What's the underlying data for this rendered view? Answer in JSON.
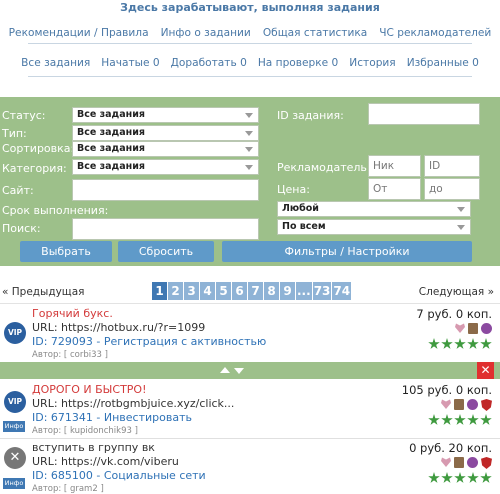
{
  "header": {
    "title": "Здесь зарабатывают, выполняя задания"
  },
  "nav_top": [
    "Рекомендации / Правила",
    "Инфо о задании",
    "Общая статистика",
    "ЧС рекламодателей"
  ],
  "nav_tabs": [
    "Все задания",
    "Начатые 0",
    "Доработать 0",
    "На проверке 0",
    "История",
    "Избранные 0"
  ],
  "filter": {
    "status_label": "Статус:",
    "status_value": "Все задания",
    "type_label": "Тип:",
    "type_value": "Все задания",
    "sort_label": "Сортировка:",
    "sort_value": "Все задания",
    "category_label": "Категория:",
    "category_value": "Все задания",
    "site_label": "Сайт:",
    "deadline_label": "Срок выполнения:",
    "search_label": "Поиск:",
    "task_id_label": "ID задания:",
    "advertiser_label": "Рекламодатель:",
    "nick_placeholder": "Ник",
    "id_placeholder": "ID",
    "price_label": "Цена:",
    "from_placeholder": "От",
    "to_placeholder": "до",
    "any_value": "Любой",
    "all_value": "По всем",
    "select_button": "Выбрать",
    "reset_button": "Сбросить",
    "settings_button": "Фильтры / Настройки"
  },
  "pager": {
    "prev": "« Предыдущая",
    "next": "Следующая »",
    "pages": [
      "1",
      "2",
      "3",
      "4",
      "5",
      "6",
      "7",
      "8",
      "9",
      "...",
      "73",
      "74"
    ],
    "current": "1"
  },
  "tasks": [
    {
      "title": "Горячий букс.",
      "title_color": "#d33a3a",
      "url": "URL: https://hotbux.ru/?r=1099",
      "id": "ID: 729093 - Регистрация с активностью",
      "author": "Автор: [ corbi33 ]",
      "price": "7 руб. 0 коп.",
      "badge": "VIP",
      "info": ""
    },
    {
      "title": "ДОРОГО И БЫСТРО!",
      "title_color": "#d33a3a",
      "url": "URL: https://rotbgmbjuice.xyz/click...",
      "id": "ID: 671341 - Инвестировать",
      "author": "Автор: [ kupidonchik93 ]",
      "price": "105 руб. 0 коп.",
      "badge": "VIP",
      "info": "Инфо"
    },
    {
      "title": "вступить в группу вк",
      "title_color": "#333333",
      "url": "URL: https://vk.com/viberu",
      "id": "ID: 685100 - Социальные сети",
      "author": "Автор: [ gram2 ]",
      "price": "0 руб. 20 коп.",
      "badge": "",
      "info": "Инфо"
    }
  ],
  "colors": {
    "accent": "#4a78a6",
    "filter_bg": "#9dc08a",
    "button": "#5f9ac9",
    "star": "#3f9a3f",
    "close": "#e03030"
  }
}
